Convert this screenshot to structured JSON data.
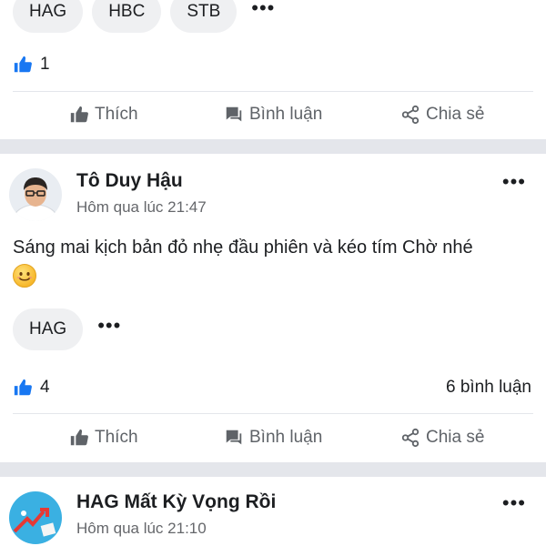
{
  "post1": {
    "tags": [
      "HAG",
      "HBC",
      "STB"
    ],
    "more": "•••",
    "like_count": "1",
    "actions": {
      "like": "Thích",
      "comment": "Bình luận",
      "share": "Chia sẻ"
    }
  },
  "post2": {
    "author": "Tô Duy Hậu",
    "time": "Hôm qua lúc 21:47",
    "more": "•••",
    "text": "Sáng mai kịch bản đỏ nhẹ đầu phiên và kéo tím Chờ nhé",
    "emoji": "smiling-face",
    "tags": [
      "HAG"
    ],
    "tag_more": "•••",
    "like_count": "4",
    "comment_count": "6 bình luận",
    "actions": {
      "like": "Thích",
      "comment": "Bình luận",
      "share": "Chia sẻ"
    }
  },
  "post3": {
    "author": "HAG Mất Kỳ Vọng Rồi",
    "time": "Hôm qua lúc 21:10",
    "more": "•••"
  },
  "icons": {
    "like": "thumbs-up-icon",
    "comment": "comment-bubble-icon",
    "share": "share-icon"
  },
  "colors": {
    "like_badge": "#1877f2",
    "divider": "#e4e6eb",
    "muted_text": "#65676b",
    "action_text": "#5f6368"
  }
}
